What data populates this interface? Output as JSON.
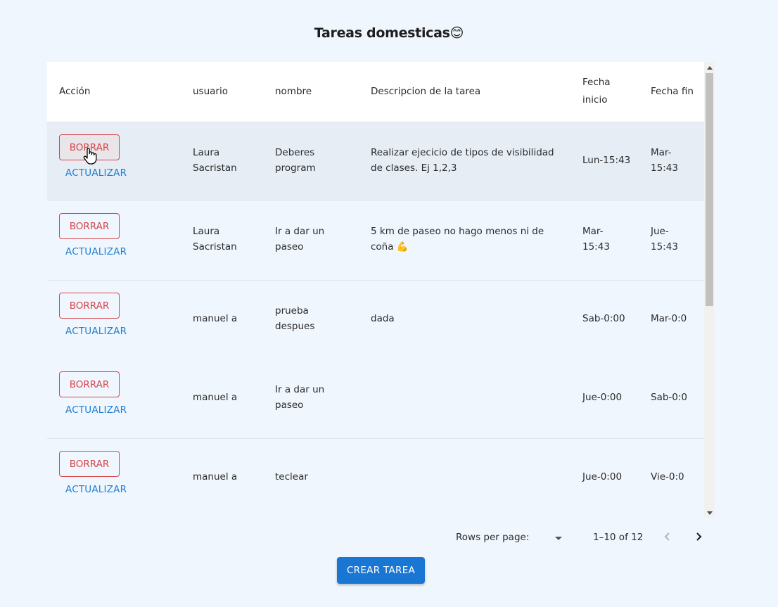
{
  "title": "Tareas domesticas😊",
  "columns": {
    "accion": "Acción",
    "usuario": "usuario",
    "nombre": "nombre",
    "descripcion": "Descripcion de la tarea",
    "fecha_inicio_1": "Fecha",
    "fecha_inicio_2": "inicio",
    "fecha_fin": "Fecha fin"
  },
  "rows": [
    {
      "borrar": "BORRAR",
      "actualizar": "ACTUALIZAR",
      "usuario_1": "Laura",
      "usuario_2": "Sacristan",
      "nombre_1": "Deberes",
      "nombre_2": "program",
      "desc_1": "Realizar ejecicio de tipos de visibilidad",
      "desc_2": "de clases. Ej 1,2,3",
      "inicio_1": "Lun-15:43",
      "inicio_2": "",
      "fin_1": "Mar-",
      "fin_2": "15:43"
    },
    {
      "borrar": "BORRAR",
      "actualizar": "ACTUALIZAR",
      "usuario_1": "Laura",
      "usuario_2": "Sacristan",
      "nombre_1": "Ir a dar un",
      "nombre_2": "paseo",
      "desc_1": "5 km de paseo no hago menos ni de",
      "desc_2": "coña 💪",
      "inicio_1": "Mar-",
      "inicio_2": "15:43",
      "fin_1": "Jue-",
      "fin_2": "15:43"
    },
    {
      "borrar": "BORRAR",
      "actualizar": "ACTUALIZAR",
      "usuario_1": "manuel a",
      "usuario_2": "",
      "nombre_1": "prueba",
      "nombre_2": "despues",
      "desc_1": "dada",
      "desc_2": "",
      "inicio_1": "Sab-0:00",
      "inicio_2": "",
      "fin_1": "Mar-0:0",
      "fin_2": ""
    },
    {
      "borrar": "BORRAR",
      "actualizar": "ACTUALIZAR",
      "usuario_1": "manuel a",
      "usuario_2": "",
      "nombre_1": "Ir a dar un",
      "nombre_2": "paseo",
      "desc_1": "",
      "desc_2": "",
      "inicio_1": "Jue-0:00",
      "inicio_2": "",
      "fin_1": "Sab-0:0",
      "fin_2": ""
    },
    {
      "borrar": "BORRAR",
      "actualizar": "ACTUALIZAR",
      "usuario_1": "manuel a",
      "usuario_2": "",
      "nombre_1": "teclear",
      "nombre_2": "",
      "desc_1": "",
      "desc_2": "",
      "inicio_1": "Jue-0:00",
      "inicio_2": "",
      "fin_1": "Vie-0:0",
      "fin_2": ""
    }
  ],
  "pagination": {
    "rows_per_page_label": "Rows per page:",
    "range": "1–10 of 12",
    "prev_icon": "chevron-left-icon",
    "next_icon": "chevron-right-icon"
  },
  "crear_label": "CREAR TAREA",
  "colors": {
    "danger": "#d6464a",
    "primary": "#1976d2",
    "link": "#1e7fd6",
    "background": "#f0f6fd"
  }
}
